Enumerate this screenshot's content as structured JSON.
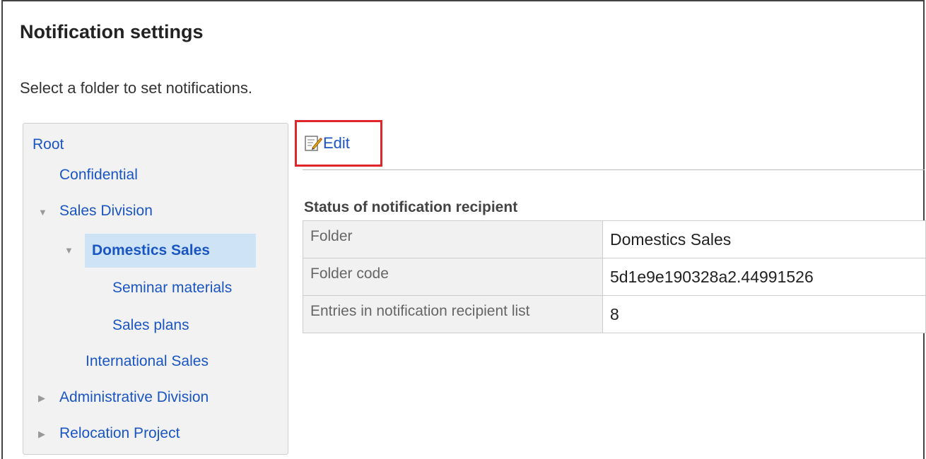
{
  "page": {
    "title": "Notification settings",
    "description": "Select a folder to set notifications."
  },
  "tree": {
    "root": "Root",
    "items": [
      {
        "label": "Confidential"
      },
      {
        "label": "Sales Division",
        "expanded": true
      },
      {
        "label": "Domestics Sales",
        "expanded": true,
        "selected": true
      },
      {
        "label": "Seminar materials"
      },
      {
        "label": "Sales plans"
      },
      {
        "label": "International Sales"
      },
      {
        "label": "Administrative Division",
        "expanded": false
      },
      {
        "label": "Relocation Project",
        "expanded": false
      }
    ]
  },
  "toolbar": {
    "edit_label": "Edit",
    "edit_icon": "edit-note-icon"
  },
  "status": {
    "title": "Status of notification recipient",
    "rows": [
      {
        "key": "Folder",
        "value": "Domestics Sales"
      },
      {
        "key": "Folder code",
        "value": "5d1e9e190328a2.44991526"
      },
      {
        "key": "Entries in notification recipient list",
        "value": "8"
      }
    ]
  },
  "colors": {
    "link": "#1a55c4",
    "selected_bg": "#cfe3f7",
    "highlight_border": "#e0262b"
  }
}
